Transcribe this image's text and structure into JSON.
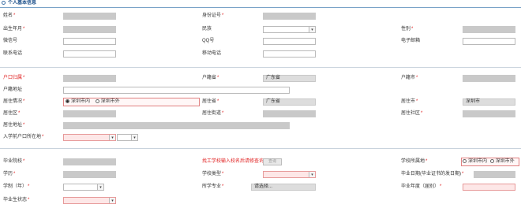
{
  "section_title": "个人基本信息",
  "basic": {
    "name_label": "姓名",
    "id_label": "身份证号",
    "birth_label": "出生年月",
    "ethnicity_label": "民族",
    "gender_label": "性别",
    "wechat_label": "微信号",
    "qq_label": "QQ号",
    "email_label": "电子邮箱",
    "phone_label": "联系电话",
    "mobile_label": "移动电话"
  },
  "residence": {
    "hukou_label": "户口归属",
    "hukou_province_label": "户籍省",
    "hukou_province_value": "广东省",
    "hukou_city_label": "户籍市",
    "hukou_address_label": "户籍地址",
    "live_status_label": "居住情况",
    "live_option_in": "深圳市内",
    "live_option_out": "深圳市外",
    "live_province_label": "居住省",
    "live_province_value": "广东省",
    "live_city_label": "居住市",
    "live_city_value": "深圳市",
    "live_district_label": "居住区",
    "live_street_label": "居住街道",
    "live_community_label": "居住社区",
    "live_address_label": "居住地址",
    "enroll_hukou_label": "入学前户口所在地"
  },
  "education": {
    "school_label": "毕业院校",
    "school_hint": "找工学校输入校名后请修查询",
    "query_button": "查询",
    "school_location_label": "学校所属地",
    "loc_option_in": "深圳市内",
    "loc_option_out": "深圳市外",
    "degree_label": "学历",
    "school_type_label": "学校类型",
    "grad_date_label": "毕业日期(毕业证书的发日期)",
    "duration_label": "学制（年）",
    "major_label": "所学专业",
    "major_placeholder": "请选择...",
    "grad_year_label": "毕业年度（届别）",
    "grad_status_label": "毕业生状态"
  }
}
